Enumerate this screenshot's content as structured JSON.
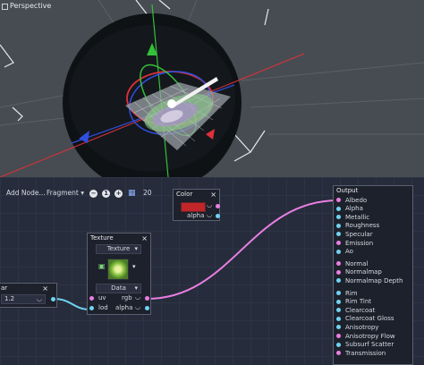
{
  "viewport": {
    "label": "Perspective"
  },
  "toolbar": {
    "add_node": "Add Node...",
    "mode": "Fragment",
    "zoom_out_symbol": "−",
    "zoom_reset_symbol": "1",
    "zoom_in_symbol": "+",
    "snap_value": "20"
  },
  "nodes": {
    "color": {
      "title": "Color",
      "close": "×",
      "swatch_color": "#c0262a",
      "port_label": "alpha"
    },
    "texture": {
      "title": "Texture",
      "close": "×",
      "source": "Texture",
      "type": "Data",
      "inputs": [
        "uv",
        "lod"
      ],
      "outputs": [
        "rgb",
        "alpha"
      ]
    },
    "scalar": {
      "title": "ar",
      "close": "×",
      "value": "1.2"
    },
    "output": {
      "title": "Output",
      "ports": [
        {
          "label": "Albedo",
          "color": "#e97ee3"
        },
        {
          "label": "Alpha",
          "color": "#6fd4f2"
        },
        {
          "label": "Metallic",
          "color": "#6fd4f2"
        },
        {
          "label": "Roughness",
          "color": "#6fd4f2"
        },
        {
          "label": "Specular",
          "color": "#6fd4f2"
        },
        {
          "label": "Emission",
          "color": "#e97ee3"
        },
        {
          "label": "Ao",
          "color": "#6fd4f2"
        },
        {
          "label": "Normal",
          "color": "#e97ee3"
        },
        {
          "label": "Normalmap",
          "color": "#e97ee3"
        },
        {
          "label": "Normalmap Depth",
          "color": "#6fd4f2"
        },
        {
          "label": "Rim",
          "color": "#6fd4f2"
        },
        {
          "label": "Rim Tint",
          "color": "#6fd4f2"
        },
        {
          "label": "Clearcoat",
          "color": "#6fd4f2"
        },
        {
          "label": "Clearcoat Gloss",
          "color": "#6fd4f2"
        },
        {
          "label": "Anisotropy",
          "color": "#6fd4f2"
        },
        {
          "label": "Anisotropy Flow",
          "color": "#e97ee3"
        },
        {
          "label": "Subsurf Scatter",
          "color": "#6fd4f2"
        },
        {
          "label": "Transmission",
          "color": "#e97ee3"
        }
      ]
    }
  },
  "colors": {
    "vector_port": "#e97ee3",
    "scalar_port": "#6fd4f2",
    "axis_x": "#e0303a",
    "axis_y": "#34c03a",
    "axis_z": "#2f4fe0"
  }
}
